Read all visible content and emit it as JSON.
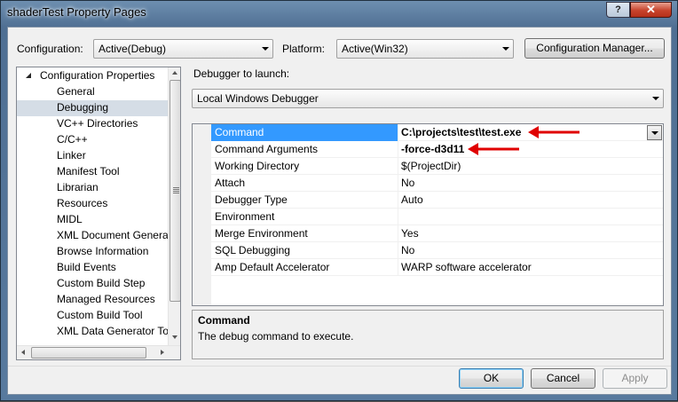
{
  "window": {
    "title": "shaderTest Property Pages",
    "help_label": "?",
    "close_label": "✕"
  },
  "config_bar": {
    "configuration_label": "Configuration:",
    "configuration_value": "Active(Debug)",
    "platform_label": "Platform:",
    "platform_value": "Active(Win32)",
    "manager_button": "Configuration Manager..."
  },
  "tree": {
    "root": "Configuration Properties",
    "items": [
      {
        "label": "General",
        "expandable": false
      },
      {
        "label": "Debugging",
        "expandable": false,
        "selected": true
      },
      {
        "label": "VC++ Directories",
        "expandable": false
      },
      {
        "label": "C/C++",
        "expandable": true
      },
      {
        "label": "Linker",
        "expandable": true
      },
      {
        "label": "Manifest Tool",
        "expandable": true
      },
      {
        "label": "Librarian",
        "expandable": true
      },
      {
        "label": "Resources",
        "expandable": true
      },
      {
        "label": "MIDL",
        "expandable": true
      },
      {
        "label": "XML Document Genera",
        "expandable": true
      },
      {
        "label": "Browse Information",
        "expandable": true
      },
      {
        "label": "Build Events",
        "expandable": true
      },
      {
        "label": "Custom Build Step",
        "expandable": true
      },
      {
        "label": "Managed Resources",
        "expandable": true
      },
      {
        "label": "Custom Build Tool",
        "expandable": true
      },
      {
        "label": "XML Data Generator To",
        "expandable": true
      }
    ]
  },
  "debugger": {
    "label": "Debugger to launch:",
    "value": "Local Windows Debugger"
  },
  "properties": [
    {
      "name": "Command",
      "value": "C:\\projects\\test\\test.exe"
    },
    {
      "name": "Command Arguments",
      "value": "-force-d3d11"
    },
    {
      "name": "Working Directory",
      "value": "$(ProjectDir)"
    },
    {
      "name": "Attach",
      "value": "No"
    },
    {
      "name": "Debugger Type",
      "value": "Auto"
    },
    {
      "name": "Environment",
      "value": ""
    },
    {
      "name": "Merge Environment",
      "value": "Yes"
    },
    {
      "name": "SQL Debugging",
      "value": "No"
    },
    {
      "name": "Amp Default Accelerator",
      "value": "WARP software accelerator"
    }
  ],
  "description": {
    "title": "Command",
    "text": "The debug command to execute."
  },
  "buttons": {
    "ok": "OK",
    "cancel": "Cancel",
    "apply": "Apply"
  },
  "colors": {
    "annotation_arrow": "#e00000",
    "selection": "#3399ff"
  }
}
